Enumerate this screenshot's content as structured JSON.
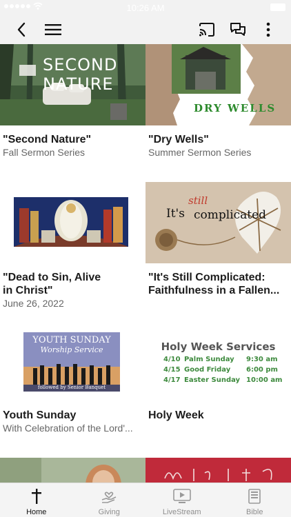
{
  "status_bar": {
    "time": "10:26 AM"
  },
  "nav": {},
  "cards": [
    {
      "title": "\"Second Nature\"",
      "subtitle": "Fall Sermon Series",
      "thumb_text": "SECOND NATURE"
    },
    {
      "title": "\"Dry Wells\"",
      "subtitle": "Summer Sermon Series",
      "thumb_text": "DRY WELLS"
    },
    {
      "title": "\"Dead to Sin, Alive in Christ\"",
      "subtitle": "June 26, 2022"
    },
    {
      "title": "\"It's Still Complicated: Faithfulness in a Fallen...",
      "subtitle": "",
      "thumb_its": "It's",
      "thumb_still": "still",
      "thumb_complicated": "complicated"
    },
    {
      "title": "Youth Sunday",
      "subtitle": "With Celebration of the Lord'...",
      "thumb_line1": "YOUTH SUNDAY",
      "thumb_line2": "Worship Service",
      "thumb_line3": "followed by Senior Banquet"
    },
    {
      "title": "Holy Week",
      "subtitle": "",
      "thumb_heading": "Holy Week Services",
      "thumb_rows": [
        {
          "date": "4/10",
          "day": "Palm Sunday",
          "time": "9:30 am"
        },
        {
          "date": "4/15",
          "day": "Good Friday",
          "time": "6:00 pm"
        },
        {
          "date": "4/17",
          "day": "Easter Sunday",
          "time": "10:00 am"
        }
      ]
    }
  ],
  "tabs": [
    {
      "label": "Home",
      "icon": "cross-icon",
      "active": true
    },
    {
      "label": "Giving",
      "icon": "giving-hand-icon",
      "active": false
    },
    {
      "label": "LiveStream",
      "icon": "livestream-icon",
      "active": false
    },
    {
      "label": "Bible",
      "icon": "bible-icon",
      "active": false
    }
  ],
  "colors": {
    "nav_bg": "#f2f2f2",
    "dry_wells_green": "#2e8b2e",
    "holy_week_green": "#3d8a3d",
    "red_banner": "#c02a3a"
  }
}
